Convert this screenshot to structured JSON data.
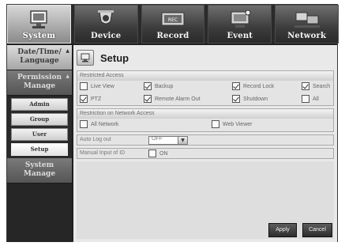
{
  "top_tabs": [
    {
      "label": "System",
      "icon": "monitor-icon",
      "active": true
    },
    {
      "label": "Device",
      "icon": "camera-icon",
      "active": false
    },
    {
      "label": "Record",
      "icon": "recorder-icon",
      "active": false
    },
    {
      "label": "Event",
      "icon": "event-monitor-icon",
      "active": false
    },
    {
      "label": "Network",
      "icon": "network-icon",
      "active": false
    }
  ],
  "sidebar": {
    "groups": [
      {
        "label_line1": "Date/Time/",
        "label_line2": "Language"
      },
      {
        "label_line1": "Permission",
        "label_line2": "Manage"
      },
      {
        "label_line1": "System",
        "label_line2": "Manage"
      }
    ],
    "items": [
      "Admin",
      "Group",
      "User",
      "Setup"
    ]
  },
  "page": {
    "title": "Setup",
    "icon": "setup-icon"
  },
  "restricted_access": {
    "title": "Restricted Access",
    "row1": [
      {
        "label": "Live View",
        "checked": false
      },
      {
        "label": "Backup",
        "checked": true
      },
      {
        "label": "Record Lock",
        "checked": true
      },
      {
        "label": "Search",
        "checked": true
      }
    ],
    "row2": [
      {
        "label": "PTZ",
        "checked": true
      },
      {
        "label": "Remote Alarm Out",
        "checked": true
      },
      {
        "label": "Shutdown",
        "checked": true
      },
      {
        "label": "All",
        "checked": false
      }
    ]
  },
  "network_access": {
    "title": "Restriction on Network Access",
    "items": [
      {
        "label": "All Network",
        "checked": false
      },
      {
        "label": "Web Viewer",
        "checked": false
      }
    ]
  },
  "auto_log_out": {
    "label": "Auto Log out",
    "value": "OFF"
  },
  "manual_input": {
    "label": "Manual Input of ID",
    "option_label": "ON",
    "checked": false
  },
  "buttons": {
    "apply": "Apply",
    "cancel": "Cancel"
  }
}
